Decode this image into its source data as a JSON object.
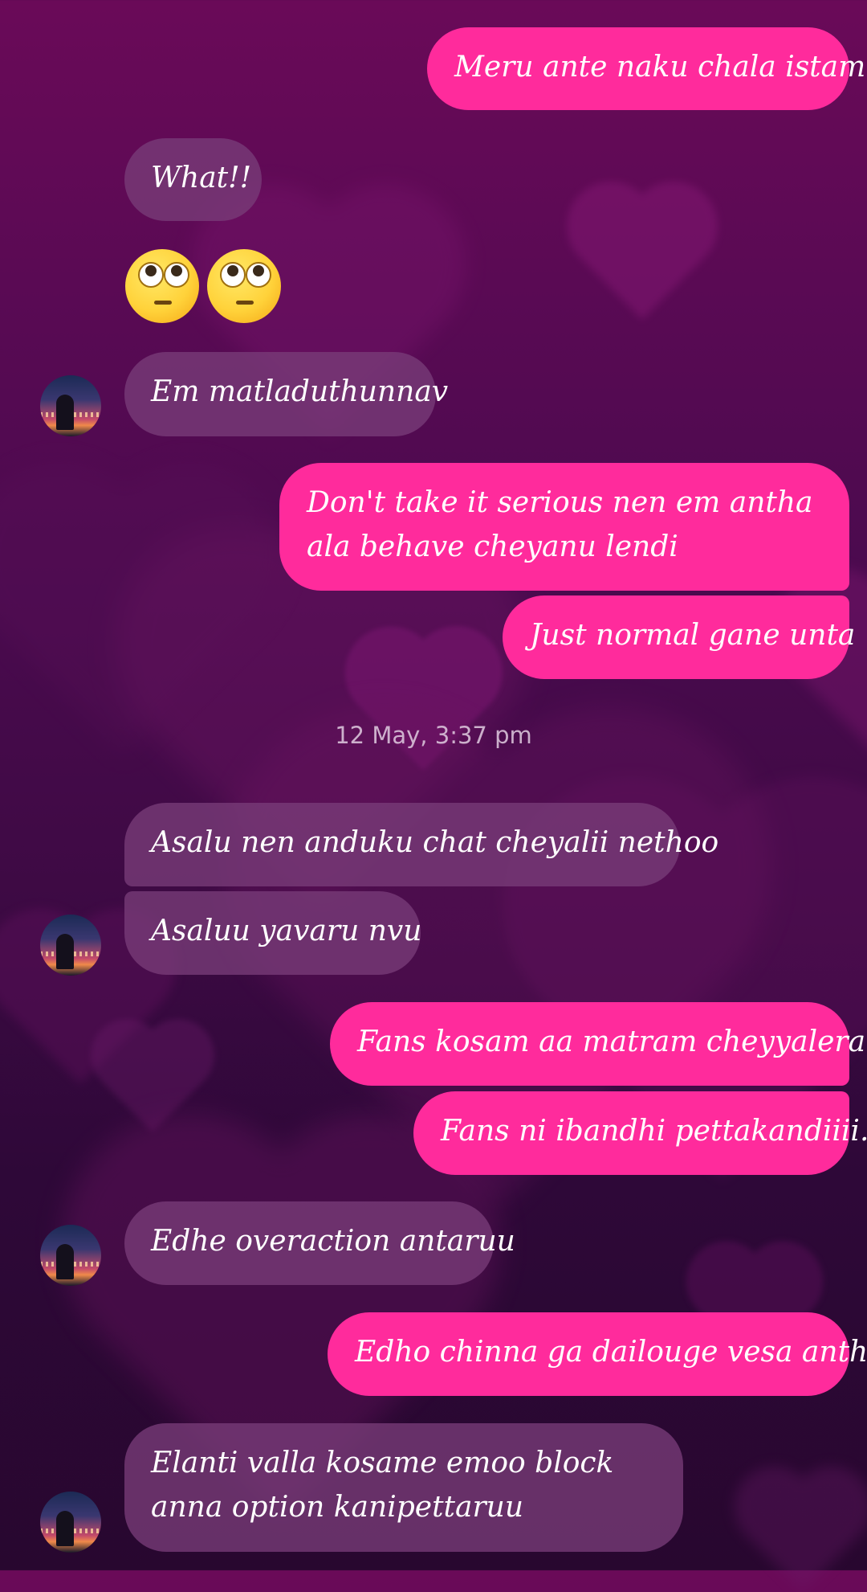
{
  "colors": {
    "outgoing_bubble": "#ff2b9c",
    "incoming_bubble": "#7a3c78",
    "background_top": "#6a0a58",
    "background_bottom": "#28072f"
  },
  "messages": [
    {
      "direction": "outgoing",
      "text": "Meru ante naku chala istam"
    },
    {
      "direction": "incoming",
      "text": "What!!"
    },
    {
      "direction": "incoming",
      "emoji": [
        "face-with-rolling-eyes",
        "face-with-rolling-eyes"
      ]
    },
    {
      "direction": "incoming",
      "text": "Em matladuthunnav"
    },
    {
      "direction": "outgoing",
      "text": "Don't take it serious nen em antha ala behave cheyanu lendi"
    },
    {
      "direction": "outgoing",
      "text": "Just normal gane unta"
    },
    {
      "direction": "incoming",
      "text": "Asalu nen anduku chat cheyalii nethoo"
    },
    {
      "direction": "incoming",
      "text": "Asaluu yavaru nvu"
    },
    {
      "direction": "outgoing",
      "text": "Fans kosam aa matram cheyyalera"
    },
    {
      "direction": "outgoing",
      "text": "Fans ni ibandhi pettakandiiii.."
    },
    {
      "direction": "incoming",
      "text": "Edhe overaction antaruu"
    },
    {
      "direction": "outgoing",
      "text": "Edho chinna ga dailouge vesa anthe"
    },
    {
      "direction": "incoming",
      "text": "Elanti valla kosame emoo block anna option kanipettaruu"
    }
  ],
  "timestamp": "12 May, 3:37 pm"
}
